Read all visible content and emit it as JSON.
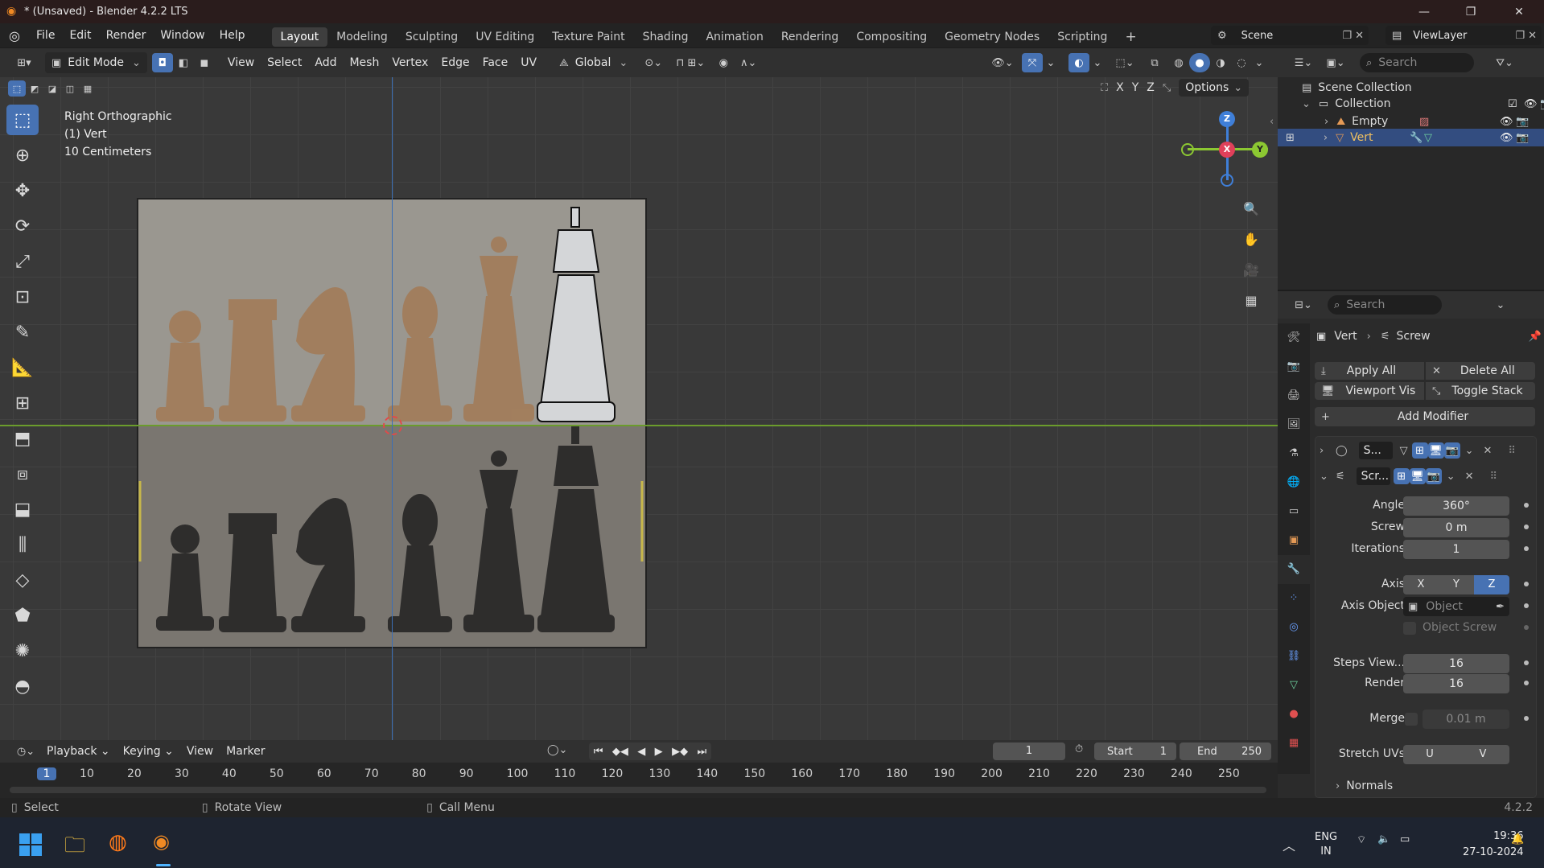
{
  "window": {
    "title": "* (Unsaved) - Blender 4.2.2 LTS",
    "minimize": "—",
    "maximize": "❐",
    "close": "✕"
  },
  "menu": [
    "File",
    "Edit",
    "Render",
    "Window",
    "Help"
  ],
  "workspaces": [
    "Layout",
    "Modeling",
    "Sculpting",
    "UV Editing",
    "Texture Paint",
    "Shading",
    "Animation",
    "Rendering",
    "Compositing",
    "Geometry Nodes",
    "Scripting"
  ],
  "active_workspace": "Layout",
  "scene": {
    "label": "Scene",
    "view_layer": "ViewLayer"
  },
  "viewport_header": {
    "mode": "Edit Mode",
    "menus": [
      "View",
      "Select",
      "Add",
      "Mesh",
      "Vertex",
      "Edge",
      "Face",
      "UV"
    ],
    "transform_orientation": "Global",
    "options": "Options",
    "axes": [
      "X",
      "Y",
      "Z"
    ]
  },
  "viewport_info": {
    "view": "Right Orthographic",
    "object": "(1) Vert",
    "scale": "10 Centimeters"
  },
  "gizmo": {
    "z": "Z",
    "x": "X",
    "y": "Y"
  },
  "outliner": {
    "search_placeholder": "Search",
    "root": "Scene Collection",
    "collection": "Collection",
    "items": [
      {
        "name": "Empty",
        "selected": false
      },
      {
        "name": "Vert",
        "selected": true
      }
    ]
  },
  "properties": {
    "search_placeholder": "Search",
    "breadcrumb_object": "Vert",
    "breadcrumb_modifier": "Screw",
    "apply_all": "Apply All",
    "delete_all": "Delete All",
    "viewport_vis": "Viewport Vis",
    "toggle_stack": "Toggle Stack",
    "add_modifier": "Add Modifier",
    "modifier1_name": "S...",
    "modifier2_name": "Scr...",
    "fields": {
      "angle_label": "Angle",
      "angle": "360°",
      "screw_label": "Screw",
      "screw": "0 m",
      "iterations_label": "Iterations",
      "iterations": "1",
      "axis_label": "Axis",
      "axis_x": "X",
      "axis_y": "Y",
      "axis_z": "Z",
      "axis_object_label": "Axis Object",
      "axis_object_placeholder": "Object",
      "object_screw_label": "Object Screw",
      "steps_view_label": "Steps View...",
      "steps_view": "16",
      "render_label": "Render",
      "render": "16",
      "merge_label": "Merge",
      "merge": "0.01 m",
      "stretch_uvs_label": "Stretch UVs",
      "stretch_u": "U",
      "stretch_v": "V",
      "normals_label": "Normals"
    }
  },
  "timeline": {
    "menus": [
      "Playback",
      "Keying",
      "View",
      "Marker"
    ],
    "current_frame": "1",
    "start_label": "Start",
    "start": "1",
    "end_label": "End",
    "end": "250",
    "ticks": [
      "1",
      "10",
      "20",
      "30",
      "40",
      "50",
      "60",
      "70",
      "80",
      "90",
      "100",
      "110",
      "120",
      "130",
      "140",
      "150",
      "160",
      "170",
      "180",
      "190",
      "200",
      "210",
      "220",
      "230",
      "240",
      "250"
    ]
  },
  "statusbar": {
    "select": "Select",
    "rotate_view": "Rotate View",
    "call_menu": "Call Menu",
    "version": "4.2.2"
  },
  "taskbar": {
    "lang1": "ENG",
    "lang2": "IN",
    "time": "19:36",
    "date": "27-10-2024"
  },
  "colors": {
    "accent": "#4772b3",
    "axis_x": "#e0405a",
    "axis_y": "#8cc832",
    "axis_z": "#3f7fd8"
  }
}
